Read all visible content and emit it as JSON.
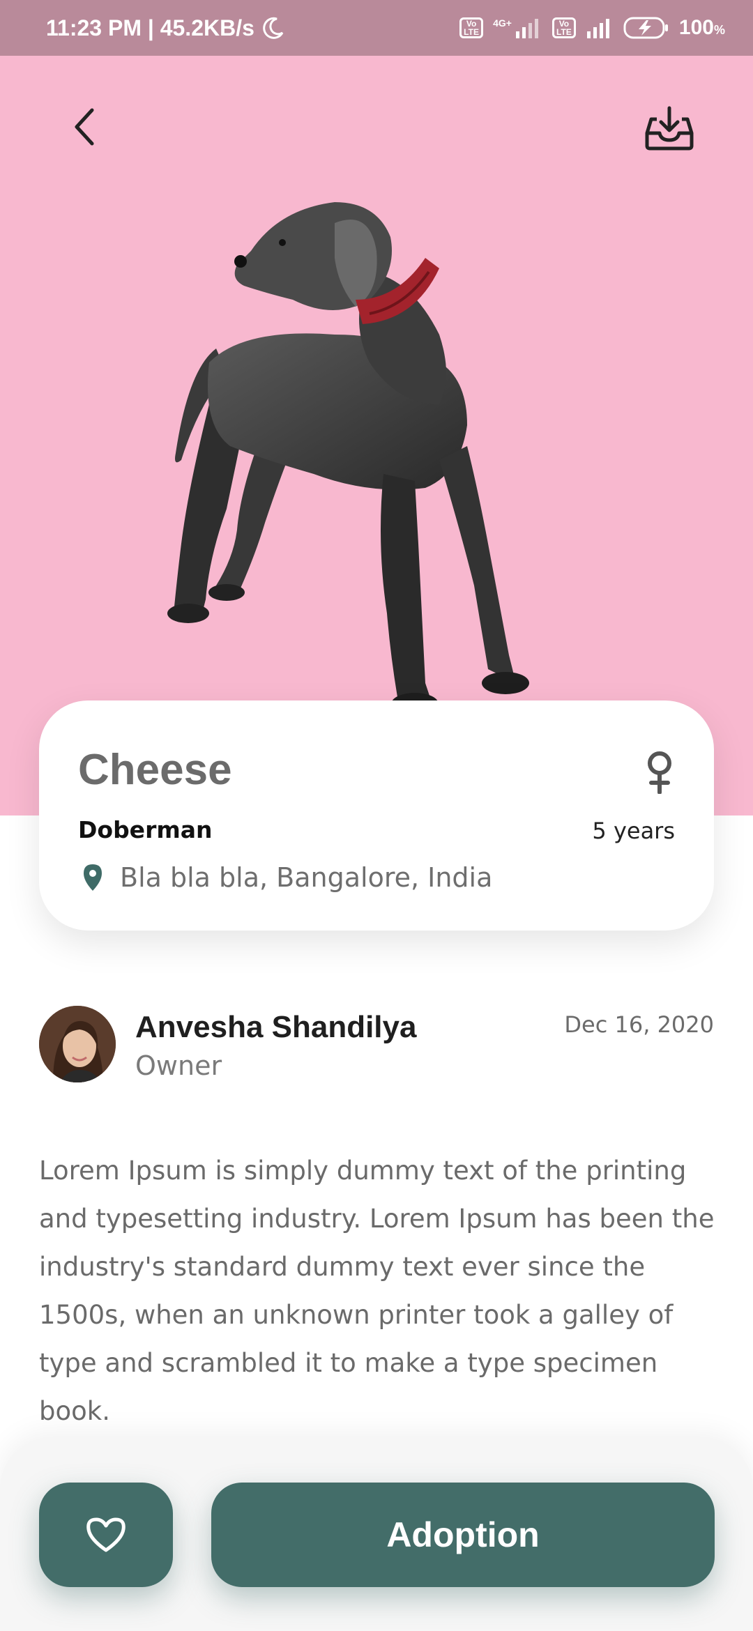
{
  "status_bar": {
    "time_network": "11:23 PM | 45.2KB/s",
    "sim1_badge": "Vo LTE",
    "network_type": "4G+",
    "sim2_badge": "Vo LTE",
    "battery_percent": "100",
    "battery_unit": "%",
    "icons": [
      "moon-icon",
      "signal-icon",
      "battery-charging-icon"
    ]
  },
  "hero": {
    "background_color": "#f8b8cf",
    "back_icon": "chevron-left-icon",
    "download_icon": "inbox-download-icon"
  },
  "pet": {
    "name": "Cheese",
    "breed": "Doberman",
    "age": "5 years",
    "gender_icon": "female-icon",
    "location": "Bla bla bla, Bangalore, India",
    "location_icon": "map-pin-icon"
  },
  "owner": {
    "name": "Anvesha Shandilya",
    "role": "Owner",
    "date": "Dec 16, 2020"
  },
  "description": "Lorem Ipsum is simply dummy text of the printing and typesetting industry. Lorem Ipsum has been the industry's standard dummy text ever since the 1500s, when an unknown printer took a galley of type and scrambled it to make a type specimen book.",
  "actions": {
    "favorite_icon": "heart-icon",
    "adopt_label": "Adoption",
    "accent_color": "#436d69"
  }
}
